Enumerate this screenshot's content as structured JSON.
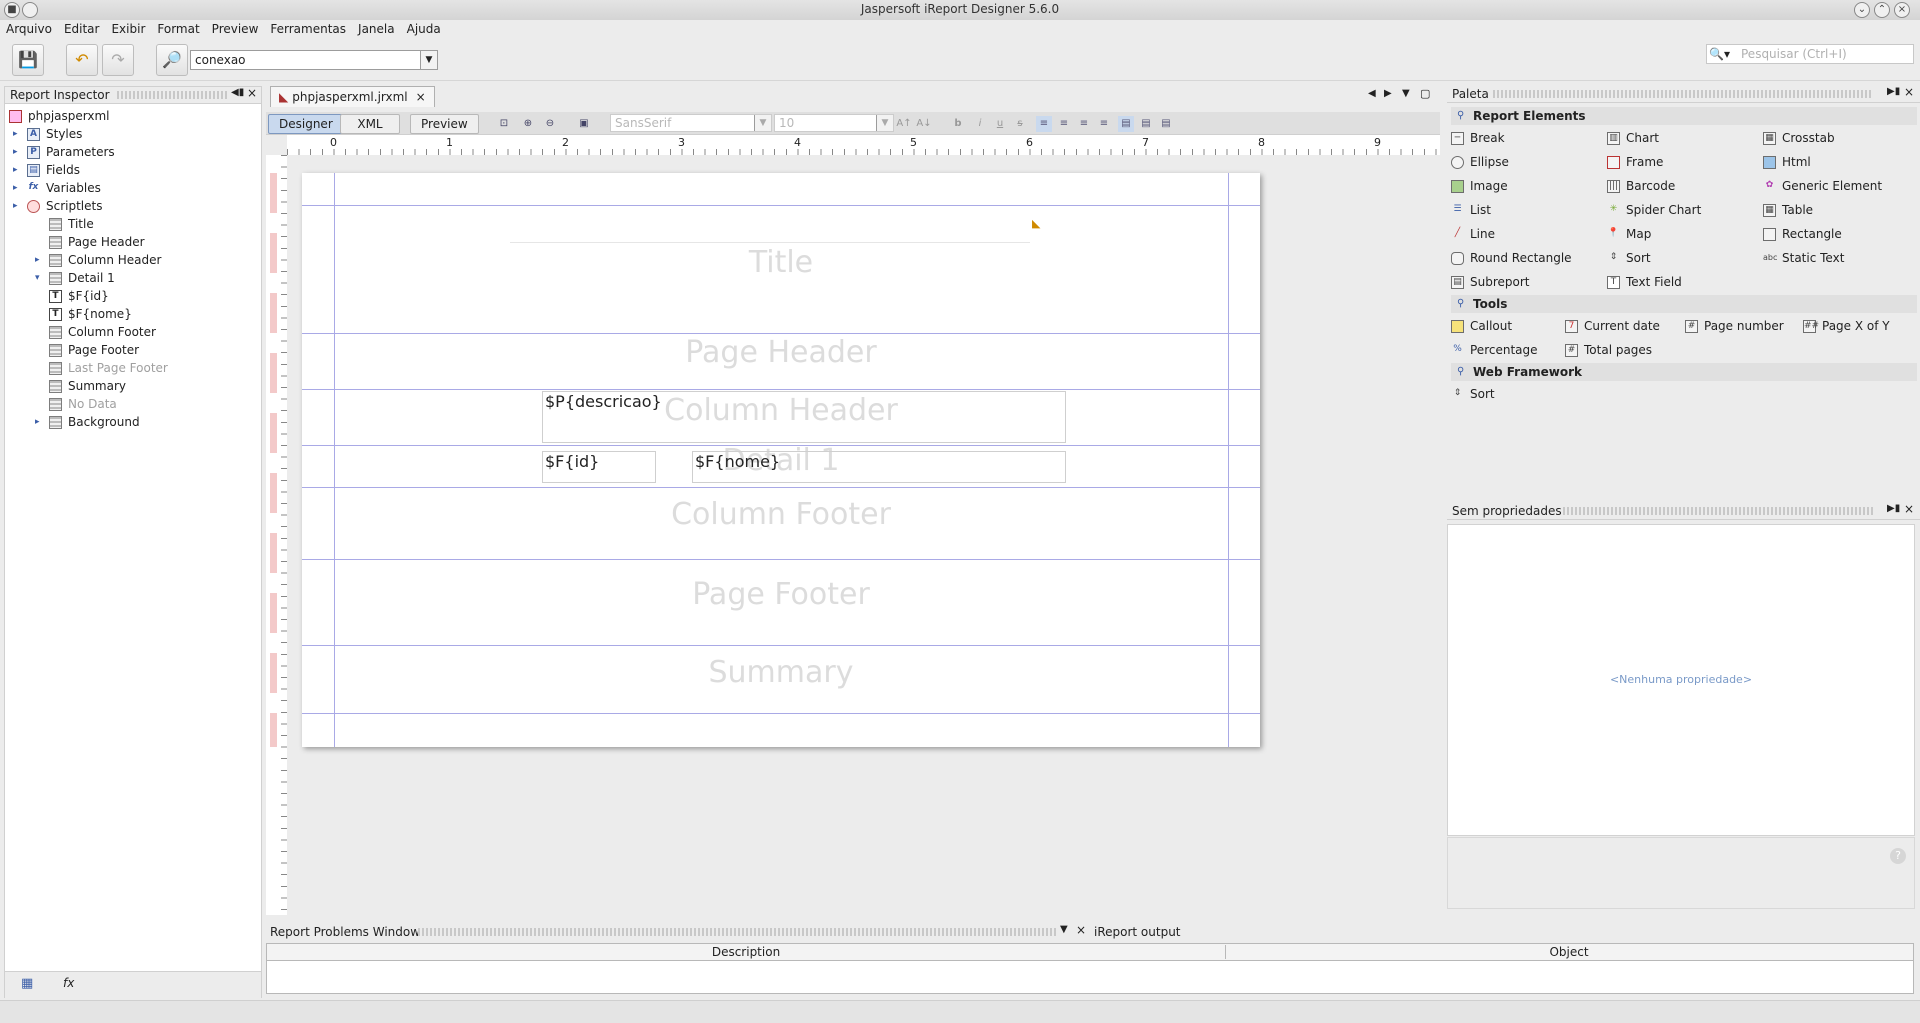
{
  "window": {
    "title": "Jaspersoft iReport Designer 5.6.0"
  },
  "menu": [
    "Arquivo",
    "Editar",
    "Exibir",
    "Format",
    "Preview",
    "Ferramentas",
    "Janela",
    "Ajuda"
  ],
  "toolbar": {
    "connection": "conexao",
    "search_placeholder": "Pesquisar (Ctrl+I)"
  },
  "inspector": {
    "title": "Report Inspector",
    "root": "phpjasperxml",
    "items": [
      {
        "label": "Styles",
        "icon": "styles-icon"
      },
      {
        "label": "Parameters",
        "icon": "parameters-icon"
      },
      {
        "label": "Fields",
        "icon": "fields-icon"
      },
      {
        "label": "Variables",
        "icon": "variables-icon"
      },
      {
        "label": "Scriptlets",
        "icon": "scriptlets-icon"
      },
      {
        "label": "Title",
        "icon": "band-icon"
      },
      {
        "label": "Page Header",
        "icon": "band-icon"
      },
      {
        "label": "Column Header",
        "icon": "band-icon"
      },
      {
        "label": "Detail 1",
        "icon": "band-icon"
      },
      {
        "label": "$F{id}",
        "icon": "textfield-icon"
      },
      {
        "label": "$F{nome}",
        "icon": "textfield-icon"
      },
      {
        "label": "Column Footer",
        "icon": "band-icon"
      },
      {
        "label": "Page Footer",
        "icon": "band-icon"
      },
      {
        "label": "Last Page Footer",
        "icon": "band-icon"
      },
      {
        "label": "Summary",
        "icon": "band-icon"
      },
      {
        "label": "No Data",
        "icon": "band-icon"
      },
      {
        "label": "Background",
        "icon": "band-icon"
      }
    ]
  },
  "editor": {
    "file_tab": "phpjasperxml.jrxml",
    "modes": [
      "Designer",
      "XML",
      "Preview"
    ],
    "font_name": "SansSerif",
    "font_size": "10",
    "ruler_marks": [
      "0",
      "1",
      "2",
      "3",
      "4",
      "5",
      "6",
      "7",
      "8",
      "9"
    ],
    "bands": [
      "Title",
      "Page Header",
      "Column Header",
      "Detail 1",
      "Column Footer",
      "Page Footer",
      "Summary"
    ],
    "fields": {
      "descricao": "$P{descricao}",
      "id": "$F{id}",
      "nome": "$F{nome}"
    }
  },
  "palette": {
    "title": "Paleta",
    "sections": [
      {
        "title": "Report Elements",
        "items": [
          "Break",
          "Chart",
          "Crosstab",
          "Ellipse",
          "Frame",
          "Html",
          "Image",
          "Barcode",
          "Generic Element",
          "List",
          "Spider Chart",
          "Table",
          "Line",
          "Map",
          "Rectangle",
          "Round Rectangle",
          "Sort",
          "Static Text",
          "Subreport",
          "Text Field"
        ]
      },
      {
        "title": "Tools",
        "items": [
          "Callout",
          "Current date",
          "Page number",
          "Page X of Y",
          "Percentage",
          "Total pages"
        ]
      },
      {
        "title": "Web Framework",
        "items": [
          "Sort"
        ]
      }
    ]
  },
  "properties": {
    "title": "Sem propriedades",
    "empty": "<Nenhuma propriedade>"
  },
  "problems": {
    "title": "Report Problems Window",
    "output_tab": "iReport output",
    "columns": [
      "Description",
      "Object"
    ]
  }
}
